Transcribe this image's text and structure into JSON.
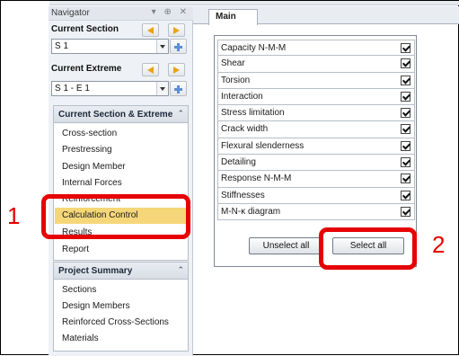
{
  "navigator": {
    "title": "Navigator",
    "window_controls": "▾ ⊕ ✕",
    "current_section_label": "Current Section",
    "current_section_value": "S 1",
    "current_extreme_label": "Current Extreme",
    "current_extreme_value": "S 1 - E 1"
  },
  "current_group": {
    "header": "Current Section & Extreme",
    "items": [
      "Cross-section",
      "Prestressing",
      "Design Member",
      "Internal Forces",
      "Reinforcement",
      "Calculation Control",
      "Results",
      "Report"
    ],
    "selected_index": 5
  },
  "project_group": {
    "header": "Project Summary",
    "items": [
      "Sections",
      "Design Members",
      "Reinforced Cross-Sections",
      "Materials"
    ]
  },
  "main": {
    "tab": "Main",
    "checks": [
      {
        "label": "Capacity N-M-M",
        "checked": true
      },
      {
        "label": "Shear",
        "checked": true
      },
      {
        "label": "Torsion",
        "checked": true
      },
      {
        "label": "Interaction",
        "checked": true
      },
      {
        "label": "Stress limitation",
        "checked": true
      },
      {
        "label": "Crack width",
        "checked": true
      },
      {
        "label": "Flexural slenderness",
        "checked": true
      },
      {
        "label": "Detailing",
        "checked": true
      },
      {
        "label": "Response N-M-M",
        "checked": true
      },
      {
        "label": "Stiffnesses",
        "checked": true
      },
      {
        "label": "M-N-κ diagram",
        "checked": true
      }
    ],
    "unselect_all": "Unselect all",
    "select_all": "Select all"
  },
  "annotations": {
    "one": "1",
    "two": "2",
    "color": "#e60000"
  },
  "colors": {
    "selection": "#f5d77a",
    "arrow": "#e9a21a",
    "plus": "#5a8fd6"
  }
}
